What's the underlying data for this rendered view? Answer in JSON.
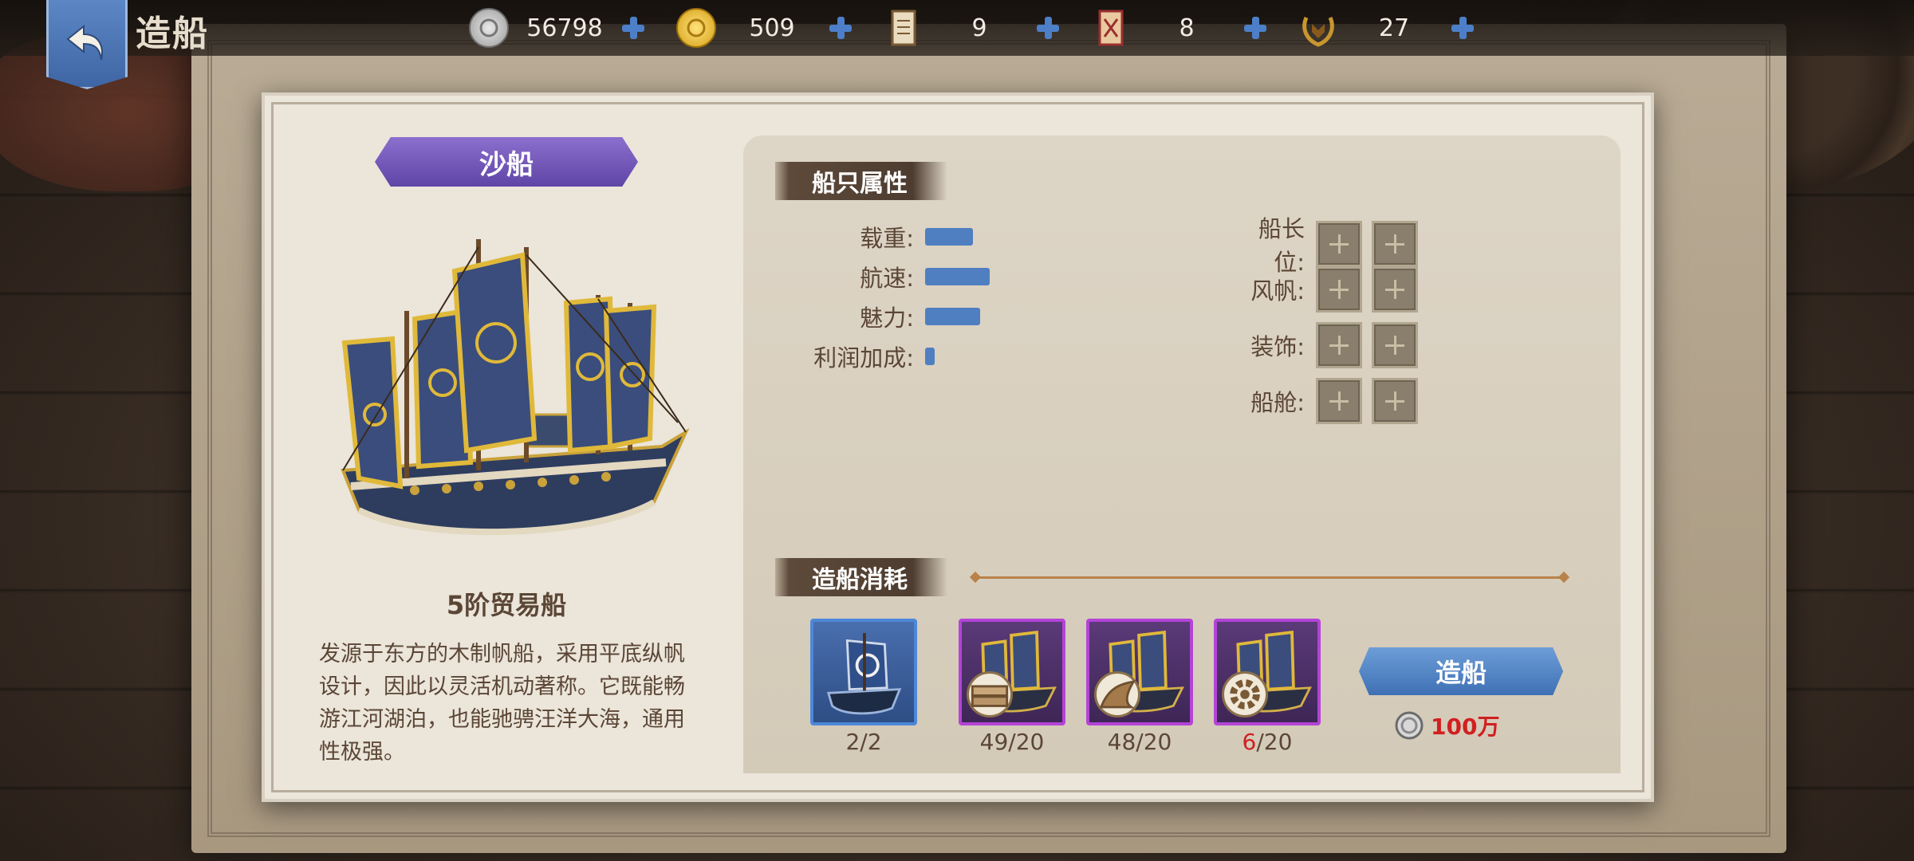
{
  "header": {
    "title": "造船",
    "currencies": [
      {
        "icon": "silver-coin-icon",
        "value": "56798"
      },
      {
        "icon": "gold-coin-icon",
        "value": "509"
      },
      {
        "icon": "scroll-icon",
        "value": "9"
      },
      {
        "icon": "order-scroll-icon",
        "value": "8"
      },
      {
        "icon": "laurel-badge-icon",
        "value": "27"
      }
    ]
  },
  "ship": {
    "name": "沙船",
    "class": "5阶贸易船",
    "description": "发源于东方的木制帆船，采用平底纵帆设计，因此以灵活机动著称。它既能畅游江河湖泊，也能驰骋汪洋大海，通用性极强。"
  },
  "attributes": {
    "title": "船只属性",
    "items": [
      {
        "label": "载重:",
        "level": 0.2
      },
      {
        "label": "航速:",
        "level": 0.27
      },
      {
        "label": "魅力:",
        "level": 0.23
      },
      {
        "label": "利润加成:",
        "level": 0.04
      }
    ],
    "slots": [
      {
        "label": "船长位:",
        "count": 2
      },
      {
        "label": "风帆:",
        "count": 2
      },
      {
        "label": "装饰:",
        "count": 2
      },
      {
        "label": "船舱:",
        "count": 2
      }
    ]
  },
  "cost": {
    "title": "造船消耗",
    "materials": [
      {
        "count": "2/2",
        "short": false,
        "have": "2",
        "need": "/2",
        "rarity": "blue",
        "icon": "blue-ship-icon"
      },
      {
        "count": "49/20",
        "short": false,
        "have": "49",
        "need": "/20",
        "rarity": "purple",
        "icon": "planks-icon"
      },
      {
        "count": "48/20",
        "short": false,
        "have": "48",
        "need": "/20",
        "rarity": "purple",
        "icon": "sail-cloth-icon"
      },
      {
        "count": "6/20",
        "short": true,
        "have": "6",
        "need": "/20",
        "rarity": "purple",
        "icon": "gear-icon"
      }
    ],
    "build_button": "造船",
    "price": "100万"
  }
}
